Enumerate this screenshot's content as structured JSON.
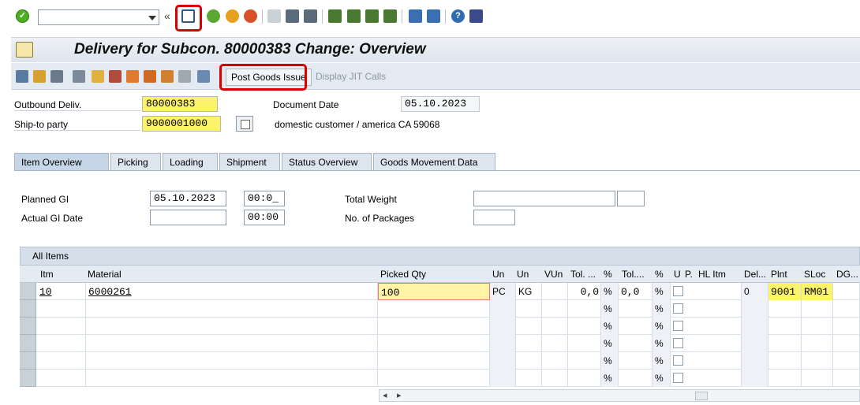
{
  "title": "Delivery for Subcon. 80000383 Change: Overview",
  "app_toolbar": {
    "post_goods_issue": "Post Goods Issue",
    "display_jit": "Display JIT Calls"
  },
  "header": {
    "outbound_label": "Outbound Deliv.",
    "outbound_value": "80000383",
    "shipto_label": "Ship-to party",
    "shipto_value": "9000001000",
    "docdate_label": "Document Date",
    "docdate_value": "05.10.2023",
    "customer_desc": "domestic customer / america CA 59068"
  },
  "tabs": [
    "Item Overview",
    "Picking",
    "Loading",
    "Shipment",
    "Status Overview",
    "Goods Movement Data"
  ],
  "overview": {
    "planned_gi_label": "Planned GI",
    "planned_gi_date": "05.10.2023",
    "planned_gi_time": "00:0_",
    "actual_gi_label": "Actual GI Date",
    "actual_gi_time": "00:00",
    "total_weight_label": "Total Weight",
    "packages_label": "No. of Packages"
  },
  "table": {
    "title": "All Items",
    "columns": [
      "Itm",
      "Material",
      "Picked Qty",
      "Un",
      "Un",
      "VUn",
      "Tol. ...",
      "%",
      "Tol....",
      "%",
      "U",
      "P.",
      "HL Itm",
      "Del...",
      "Plnt",
      "SLoc",
      "DG..."
    ],
    "row1": {
      "itm": "10",
      "material": "6000261",
      "picked_qty": "100",
      "un1": "PC",
      "un2": "KG",
      "tol1": "0,0",
      "pct1": "%",
      "tol2": "0,0",
      "pct2": "%",
      "del": "0",
      "plnt": "9001",
      "sloc": "RM01"
    },
    "pct": "%"
  },
  "colors": {
    "highlight": "#fbf36a",
    "annotation_red": "#d60000"
  },
  "icons": [
    "check-icon",
    "save-icon",
    "back-icon",
    "exit-icon",
    "cancel-icon",
    "print-icon",
    "find-icon",
    "find-next-icon",
    "first-page-icon",
    "prev-page-icon",
    "next-page-icon",
    "last-page-icon",
    "new-session-icon",
    "shortcut-icon",
    "help-icon",
    "customize-layout-icon"
  ]
}
